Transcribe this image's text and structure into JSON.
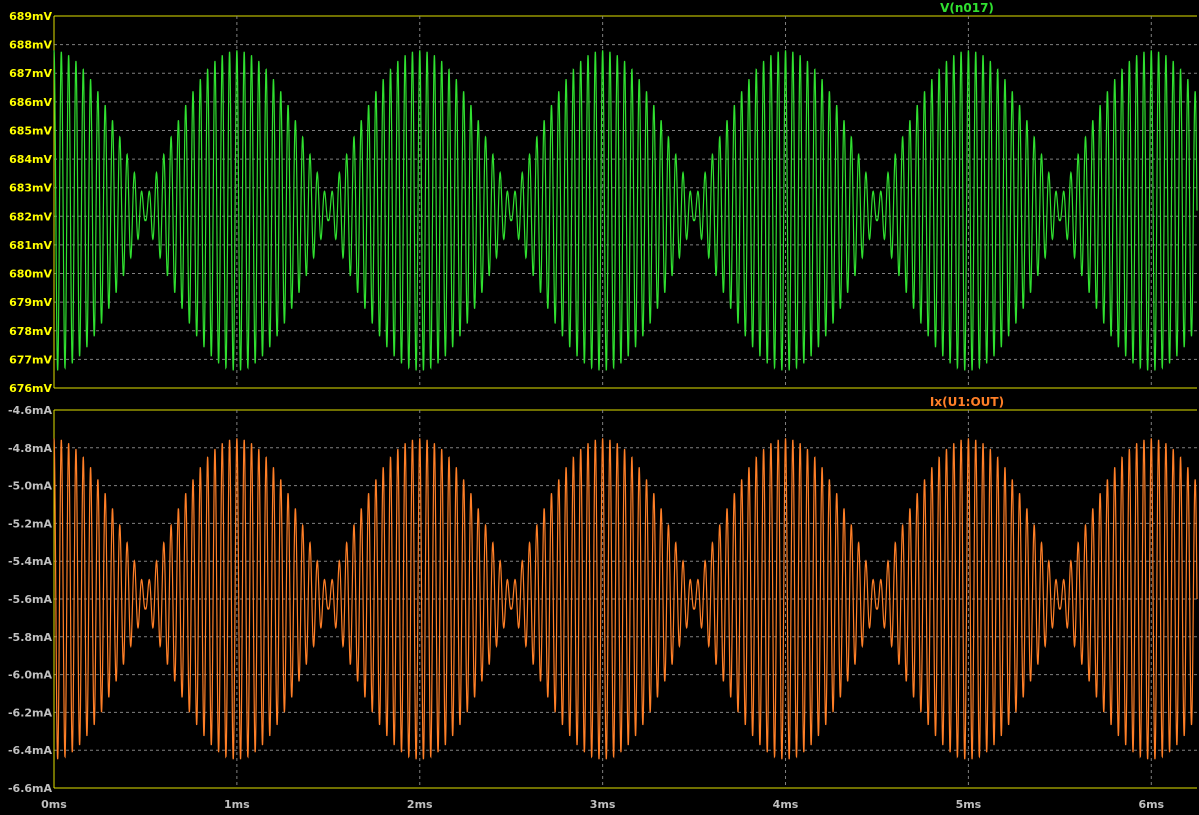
{
  "chart_data": [
    {
      "type": "line",
      "trace_label": "V(n017)",
      "trace_color": "#30e030",
      "label_color": "#ffff00",
      "y_unit": "mV",
      "y_ticks": [
        "689mV",
        "688mV",
        "687mV",
        "686mV",
        "685mV",
        "684mV",
        "683mV",
        "682mV",
        "681mV",
        "680mV",
        "679mV",
        "678mV",
        "677mV",
        "676mV"
      ],
      "ylim": [
        676,
        689
      ],
      "series": [
        {
          "name": "V(n017)",
          "model": {
            "offset": 682.2,
            "envelope_amplitude": 5.6,
            "carrier_frequency_khz": 25,
            "envelope_zero_times_ms": [
              0.5,
              1.5,
              2.5,
              3.5,
              4.5,
              5.5
            ]
          }
        }
      ]
    },
    {
      "type": "line",
      "trace_label": "Ix(U1:OUT)",
      "trace_color": "#ff7f27",
      "label_color": "#c0c0c0",
      "y_unit": "mA",
      "y_ticks": [
        "-4.6mA",
        "-4.8mA",
        "-5.0mA",
        "-5.2mA",
        "-5.4mA",
        "-5.6mA",
        "-5.8mA",
        "-6.0mA",
        "-6.2mA",
        "-6.4mA",
        "-6.6mA"
      ],
      "ylim": [
        -6.6,
        -4.6
      ],
      "series": [
        {
          "name": "Ix(U1:OUT)",
          "model": {
            "offset": -5.6,
            "envelope_amplitude": 0.85,
            "carrier_frequency_khz": 25,
            "envelope_zero_times_ms": [
              0.5,
              1.5,
              2.5,
              3.5,
              4.5,
              5.5
            ]
          }
        }
      ]
    }
  ],
  "x_axis": {
    "ticks": [
      "0ms",
      "1ms",
      "2ms",
      "3ms",
      "4ms",
      "5ms",
      "6ms"
    ],
    "xlim_ms": [
      0,
      6.25
    ]
  },
  "colors": {
    "background": "#000000",
    "pane_border": "#e0e000",
    "grid": "#808080",
    "x_tick_label": "#c0c0c0"
  }
}
